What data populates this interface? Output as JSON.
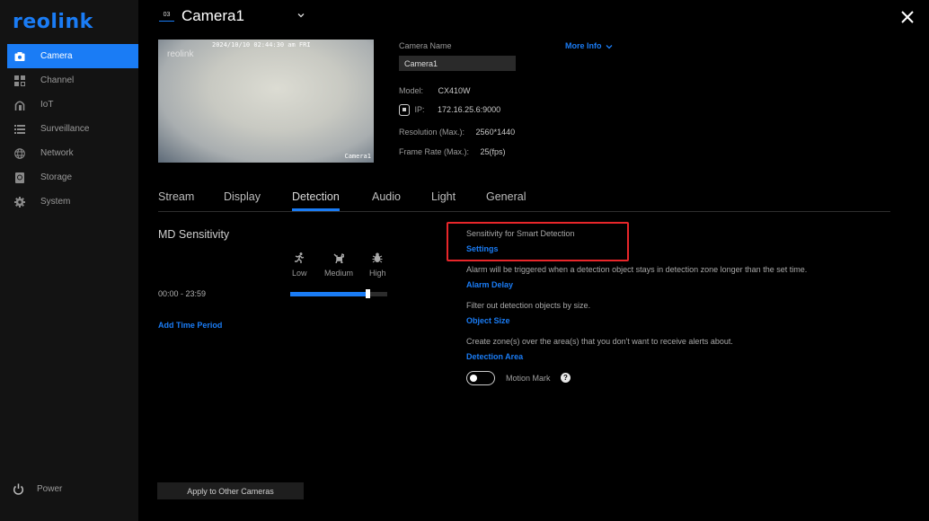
{
  "brand": {
    "logo_text": "reolink",
    "accent_color": "#1a7cf5",
    "highlight_color": "#e8262a"
  },
  "sidebar": {
    "items": [
      {
        "label": "Camera",
        "icon": "camera-icon",
        "active": true
      },
      {
        "label": "Channel",
        "icon": "grid-icon",
        "active": false
      },
      {
        "label": "IoT",
        "icon": "home-icon",
        "active": false
      },
      {
        "label": "Surveillance",
        "icon": "list-icon",
        "active": false
      },
      {
        "label": "Network",
        "icon": "globe-icon",
        "active": false
      },
      {
        "label": "Storage",
        "icon": "storage-icon",
        "active": false
      },
      {
        "label": "System",
        "icon": "gear-icon",
        "active": false
      }
    ],
    "power_label": "Power"
  },
  "header": {
    "channel_badge": "03",
    "camera_title": "Camera1"
  },
  "preview": {
    "timestamp": "2024/10/10 02:44:30 am FRI",
    "watermark": "reolink",
    "overlay_name": "Camera1"
  },
  "info": {
    "camera_name_label": "Camera Name",
    "camera_name_value": "Camera1",
    "more_info_label": "More Info",
    "model_label": "Model:",
    "model_value": "CX410W",
    "ip_label": "IP:",
    "ip_value": "172.16.25.6:9000",
    "resolution_label": "Resolution (Max.):",
    "resolution_value": "2560*1440",
    "framerate_label": "Frame Rate (Max.):",
    "framerate_value": "25(fps)"
  },
  "tabs": [
    {
      "label": "Stream",
      "active": false
    },
    {
      "label": "Display",
      "active": false
    },
    {
      "label": "Detection",
      "active": true
    },
    {
      "label": "Audio",
      "active": false
    },
    {
      "label": "Light",
      "active": false
    },
    {
      "label": "General",
      "active": false
    }
  ],
  "md": {
    "title": "MD Sensitivity",
    "levels": [
      "Low",
      "Medium",
      "High"
    ],
    "time_range": "00:00 - 23:59",
    "sensitivity_fraction": 0.8,
    "add_time_label": "Add Time Period"
  },
  "detection": {
    "smart_label": "Sensitivity for Smart Detection",
    "smart_link": "Settings",
    "alarm_desc": "Alarm will be triggered when a detection object stays in detection zone longer than the set time.",
    "alarm_link": "Alarm Delay",
    "size_desc": "Filter out detection objects by size.",
    "size_link": "Object Size",
    "area_desc": "Create zone(s) over the area(s) that you don't want to receive alerts about.",
    "area_link": "Detection Area",
    "motion_mark_label": "Motion Mark",
    "motion_mark_on": false,
    "help_glyph": "?"
  },
  "footer": {
    "apply_label": "Apply to Other Cameras"
  }
}
